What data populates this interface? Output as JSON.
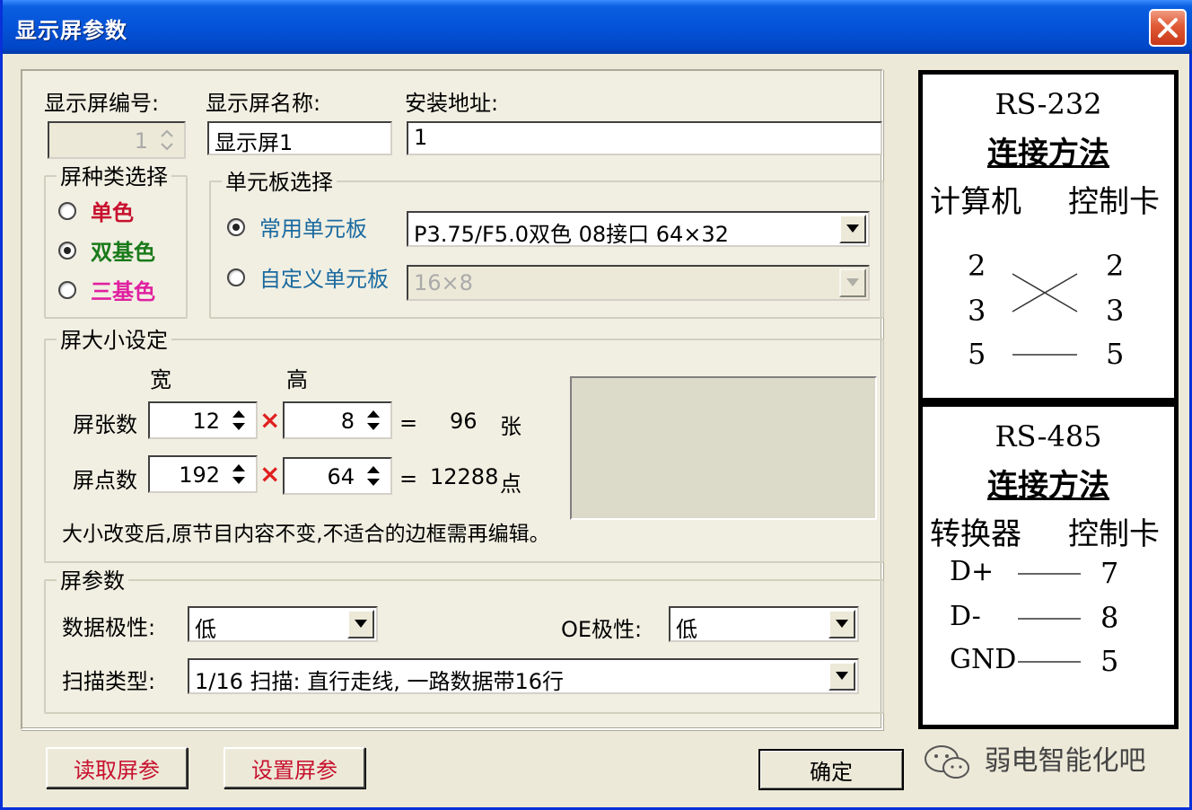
{
  "window": {
    "title": "显示屏参数"
  },
  "fields": {
    "screen_number_label": "显示屏编号:",
    "screen_number_value": "1",
    "screen_name_label": "显示屏名称:",
    "screen_name_value": "显示屏1",
    "install_address_label": "安装地址:",
    "install_address_value": "1"
  },
  "screen_type": {
    "caption": "屏种类选择",
    "options": [
      {
        "label": "单色",
        "color": "#c8102e",
        "selected": false
      },
      {
        "label": "双基色",
        "color": "#1a7a1a",
        "selected": true
      },
      {
        "label": "三基色",
        "color": "#e020a0",
        "selected": false
      }
    ]
  },
  "unit_board": {
    "caption": "单元板选择",
    "common_label": "常用单元板",
    "custom_label": "自定义单元板",
    "common_value": "P3.75/F5.0双色 08接口 64×32",
    "custom_value": "16×8",
    "label_color": "#1a6aa0"
  },
  "size": {
    "caption": "屏大小设定",
    "width_header": "宽",
    "height_header": "高",
    "panels_label": "屏张数",
    "panels_w": "12",
    "panels_h": "8",
    "panels_equals": "=",
    "panels_total": "96",
    "panels_unit": "张",
    "dots_label": "屏点数",
    "dots_w": "192",
    "dots_h": "64",
    "dots_equals": "=",
    "dots_total": "12288",
    "dots_unit": "点",
    "times": "×",
    "note": "大小改变后,原节目内容不变,不适合的边框需再编辑。"
  },
  "params": {
    "caption": "屏参数",
    "data_polarity_label": "数据极性:",
    "data_polarity_value": "低",
    "oe_polarity_label": "OE极性:",
    "oe_polarity_value": "低",
    "scan_type_label": "扫描类型:",
    "scan_type_value": "1/16 扫描: 直行走线, 一路数据带16行"
  },
  "buttons": {
    "read_params": "读取屏参",
    "set_params": "设置屏参",
    "ok": "确定"
  },
  "rs232": {
    "title": "RS-232",
    "subtitle": "连接方法",
    "left_header": "计算机",
    "right_header": "控制卡",
    "left": [
      "2",
      "3",
      "5"
    ],
    "right": [
      "2",
      "3",
      "5"
    ]
  },
  "rs485": {
    "title": "RS-485",
    "subtitle": "连接方法",
    "left_header": "转换器",
    "right_header": "控制卡",
    "left": [
      "D+",
      "D-",
      "GND"
    ],
    "right": [
      "7",
      "8",
      "5"
    ]
  },
  "watermark": "弱电智能化吧"
}
